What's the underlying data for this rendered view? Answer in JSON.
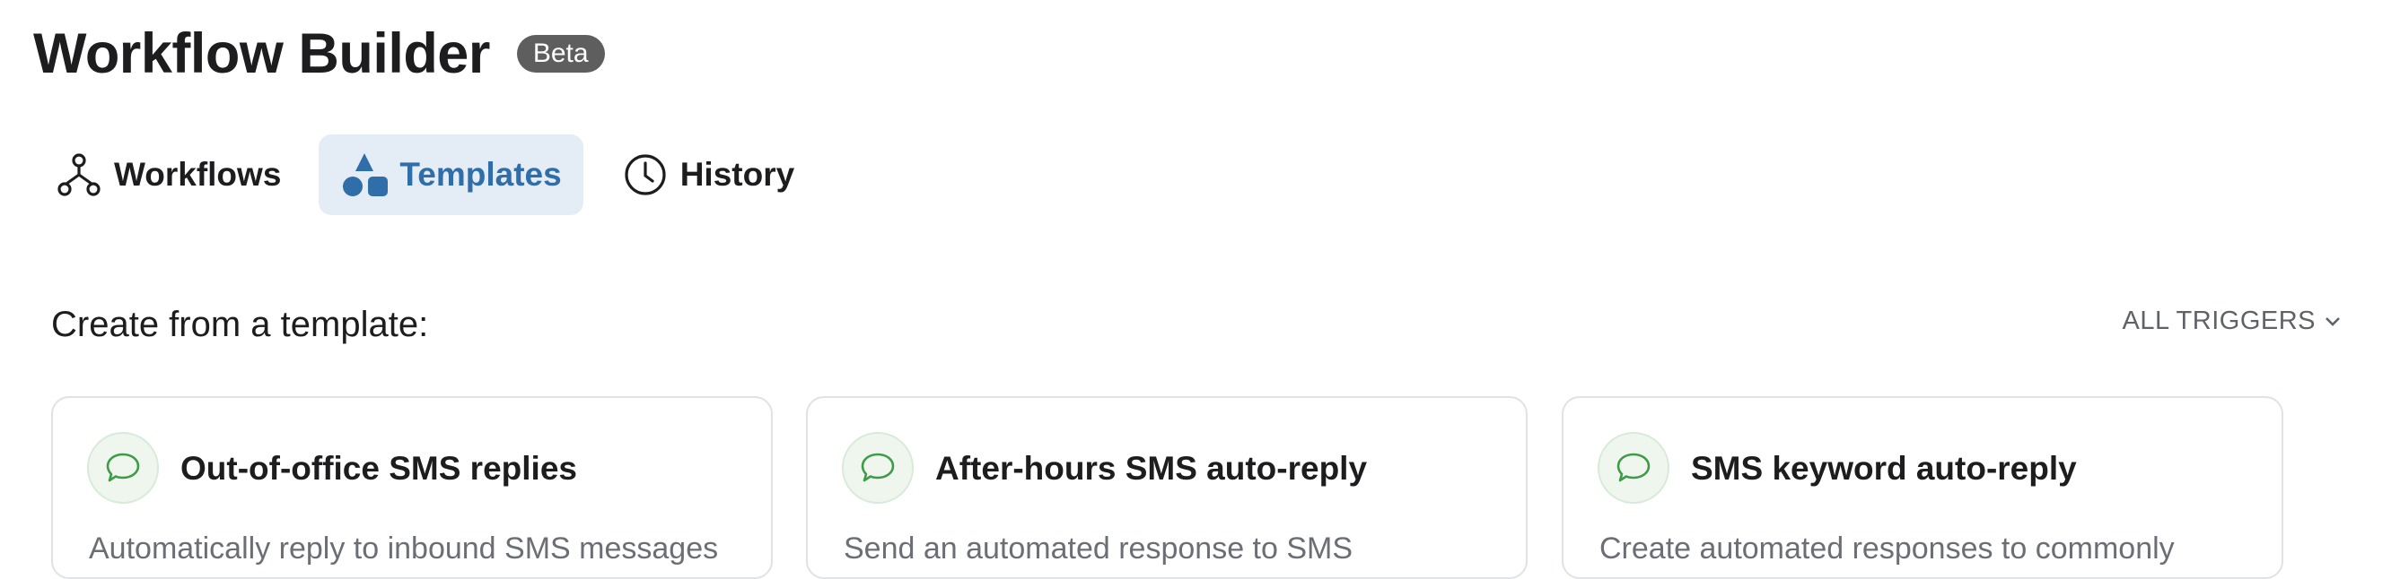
{
  "header": {
    "title": "Workflow Builder",
    "badge": "Beta"
  },
  "tabs": [
    {
      "label": "Workflows",
      "icon": "workflow-icon",
      "active": false
    },
    {
      "label": "Templates",
      "icon": "templates-shapes-icon",
      "active": true
    },
    {
      "label": "History",
      "icon": "clock-icon",
      "active": false
    }
  ],
  "main": {
    "section_label": "Create from a template:",
    "filter_label": "ALL TRIGGERS",
    "filter_icon": "chevron-down-icon"
  },
  "cards": [
    {
      "title": "Out-of-office SMS replies",
      "description": "Automatically reply to inbound SMS messages",
      "icon": "chat-bubble-icon"
    },
    {
      "title": "After-hours SMS auto-reply",
      "description": "Send an automated response to SMS",
      "icon": "chat-bubble-icon"
    },
    {
      "title": "SMS keyword auto-reply",
      "description": "Create automated responses to commonly",
      "icon": "chat-bubble-icon"
    }
  ],
  "colors": {
    "accent": "#2f6ea8",
    "active_tab_bg": "#e4edf6",
    "badge_bg": "#5e5e5e",
    "card_icon_green": "#3f9b47",
    "card_border": "#dfe2e6"
  }
}
